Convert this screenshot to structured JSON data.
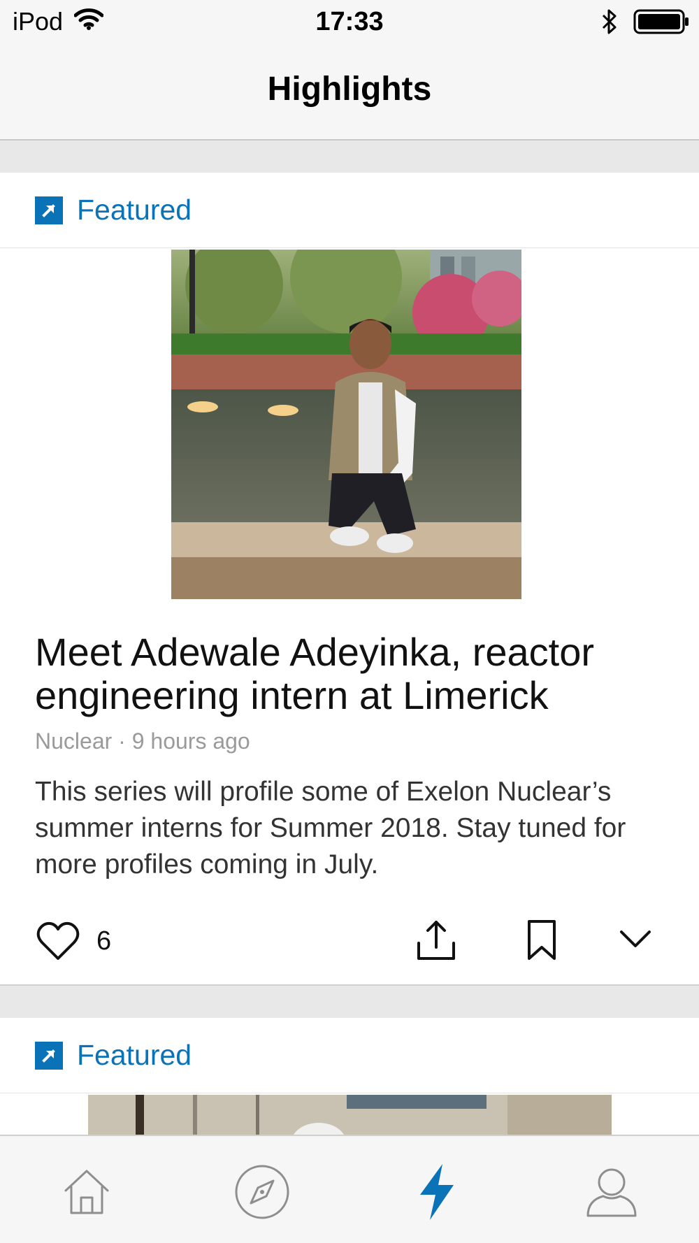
{
  "status_bar": {
    "carrier": "iPod",
    "time": "17:33"
  },
  "nav": {
    "title": "Highlights"
  },
  "cards": [
    {
      "section_label": "Featured",
      "headline": "Meet Adewale Adeyinka, reactor engineering intern at Limerick",
      "meta": "Nuclear · 9 hours ago",
      "description": "This series will profile some of Exelon Nuclear’s summer interns for Summer 2018. Stay tuned for more profiles coming in July.",
      "like_count": "6"
    },
    {
      "section_label": "Featured"
    }
  ],
  "icons": {
    "wifi": "wifi-icon",
    "bluetooth": "bluetooth-icon",
    "battery": "battery-icon",
    "featured": "arrow-up-right-icon",
    "like": "heart-icon",
    "share": "share-icon",
    "bookmark": "bookmark-icon",
    "more": "chevron-down-icon",
    "tab_home": "home-icon",
    "tab_discover": "compass-icon",
    "tab_highlights": "lightning-icon",
    "tab_profile": "person-icon"
  },
  "colors": {
    "accent": "#0a73b7",
    "tab_inactive": "#8e8e8e"
  },
  "tabs": {
    "active": "highlights"
  }
}
